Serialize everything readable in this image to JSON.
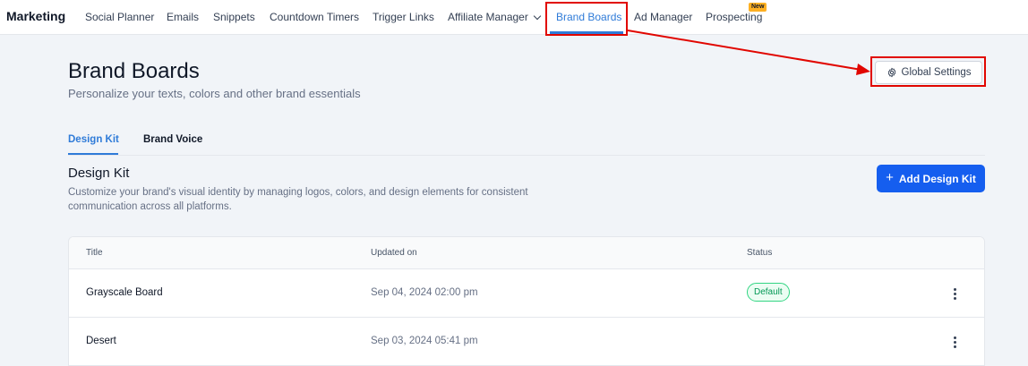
{
  "nav": {
    "brand": "Marketing",
    "items": [
      {
        "label": "Social Planner"
      },
      {
        "label": "Emails"
      },
      {
        "label": "Snippets"
      },
      {
        "label": "Countdown Timers"
      },
      {
        "label": "Trigger Links"
      },
      {
        "label": "Affiliate Manager"
      },
      {
        "label": "Brand Boards"
      },
      {
        "label": "Ad Manager"
      },
      {
        "label": "Prospecting"
      }
    ],
    "new_badge": "New",
    "active_color": "#2f7bd8"
  },
  "header": {
    "title": "Brand Boards",
    "subtitle": "Personalize your texts, colors and other brand essentials",
    "global_settings_label": "Global Settings",
    "global_settings_icon": "gear-icon"
  },
  "tabs": [
    {
      "label": "Design Kit",
      "active": true
    },
    {
      "label": "Brand Voice",
      "active": false
    }
  ],
  "section": {
    "title": "Design Kit",
    "description": "Customize your brand's visual identity by managing logos, colors, and design elements for consistent communication across all platforms.",
    "add_button_label": "Add Design Kit",
    "add_button_color": "#155eef"
  },
  "table": {
    "columns": [
      "Title",
      "Updated on",
      "Status"
    ],
    "rows": [
      {
        "title": "Grayscale Board",
        "updated_on": "Sep 04, 2024 02:00 pm",
        "status": "Default"
      },
      {
        "title": "Desert",
        "updated_on": "Sep 03, 2024 05:41 pm",
        "status": ""
      }
    ]
  },
  "annotation_color": "#e10600"
}
